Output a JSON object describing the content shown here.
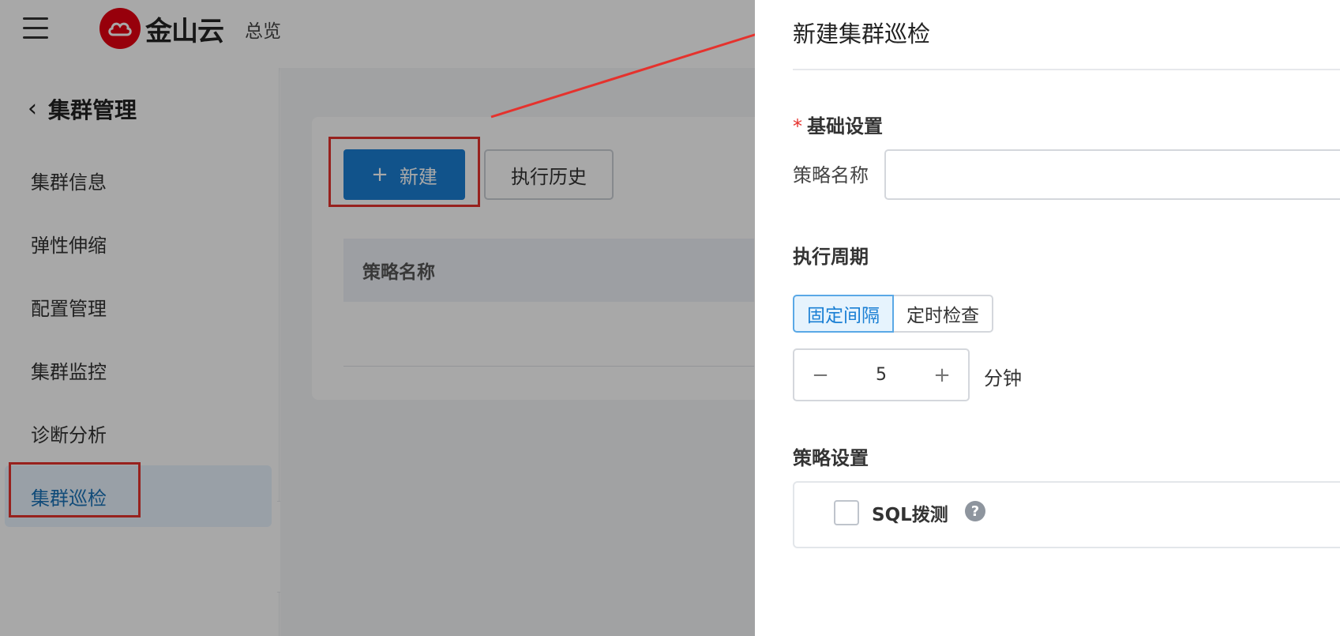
{
  "header": {
    "logo_text": "金山云",
    "overview": "总览"
  },
  "sidebar": {
    "title": "集群管理",
    "items": [
      {
        "label": "集群信息"
      },
      {
        "label": "弹性伸缩"
      },
      {
        "label": "配置管理"
      },
      {
        "label": "集群监控"
      },
      {
        "label": "诊断分析"
      },
      {
        "label": "集群巡检",
        "active": true
      }
    ]
  },
  "toolbar": {
    "new_label": "新建",
    "history_label": "执行历史"
  },
  "table": {
    "columns": [
      "策略名称"
    ]
  },
  "drawer": {
    "title": "新建集群巡检",
    "basic_section": "基础设置",
    "name_label": "策略名称",
    "name_value": "",
    "period_section": "执行周期",
    "period_options": [
      "固定间隔",
      "定时检查"
    ],
    "period_selected": "固定间隔",
    "interval_value": "5",
    "interval_unit": "分钟",
    "strategy_section": "策略设置",
    "sql_probe_label": "SQL拨测",
    "sql_probe_checked": false
  },
  "colors": {
    "brand_red": "#e60012",
    "primary_blue": "#1a7fd4",
    "annotation_red": "#e5322d"
  },
  "icons": {
    "menu": "hamburger-icon",
    "back": "chevron-left-icon",
    "plus": "plus-icon",
    "minus": "minus-icon",
    "help": "question-circle-icon",
    "collapse": "triangle-left-icon"
  }
}
